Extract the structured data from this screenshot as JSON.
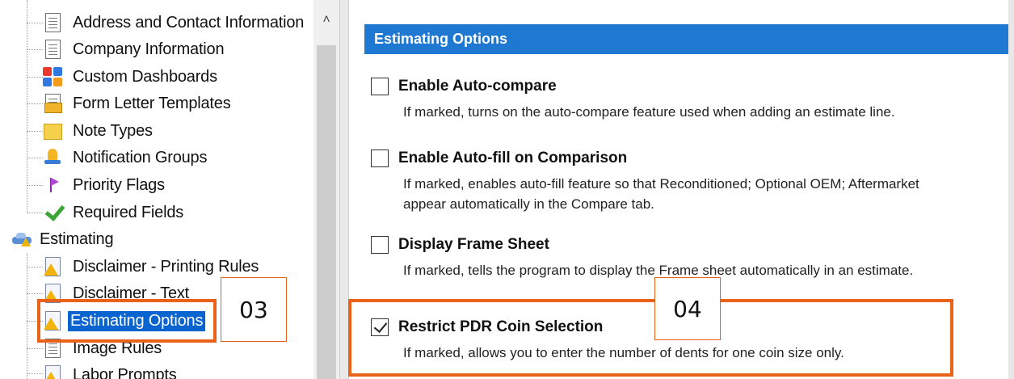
{
  "tree": {
    "items": [
      {
        "label": "Address and Contact Information",
        "icon": "document-list-icon"
      },
      {
        "label": "Company Information",
        "icon": "document-list-icon"
      },
      {
        "label": "Custom Dashboards",
        "icon": "dashboard-tiles-icon"
      },
      {
        "label": "Form Letter Templates",
        "icon": "form-letter-icon"
      },
      {
        "label": "Note Types",
        "icon": "sticky-note-icon"
      },
      {
        "label": "Notification Groups",
        "icon": "notification-bell-icon"
      },
      {
        "label": "Priority Flags",
        "icon": "flag-icon"
      },
      {
        "label": "Required Fields",
        "icon": "checkmark-icon"
      }
    ],
    "group": {
      "label": "Estimating",
      "icon": "estimating-car-icon"
    },
    "children": [
      {
        "label": "Disclaimer - Printing Rules",
        "icon": "warning-document-icon"
      },
      {
        "label": "Disclaimer - Text",
        "icon": "warning-document-icon"
      },
      {
        "label": "Estimating Options",
        "icon": "warning-document-icon",
        "selected": true
      },
      {
        "label": "Image Rules",
        "icon": "document-list-icon"
      },
      {
        "label": "Labor Prompts",
        "icon": "warning-document-icon"
      }
    ]
  },
  "options": {
    "header": "Estimating Options",
    "items": [
      {
        "title": "Enable Auto-compare",
        "checked": false,
        "desc": [
          "If marked, turns on the auto-compare feature used when adding an estimate line."
        ]
      },
      {
        "title": "Enable Auto-fill on Comparison",
        "checked": false,
        "desc": [
          "If marked, enables auto-fill feature so that Reconditioned; Optional OEM; Aftermarket",
          "appear automatically in the Compare tab."
        ]
      },
      {
        "title": "Display Frame Sheet",
        "checked": false,
        "desc": [
          "If marked, tells the program to display the Frame sheet automatically in an estimate."
        ]
      },
      {
        "title": "Restrict PDR Coin Selection",
        "checked": true,
        "desc": [
          "If marked, allows you to enter the number of dents for one coin size only."
        ]
      }
    ]
  },
  "callouts": {
    "left": "03",
    "right": "04"
  },
  "colors": {
    "accent": "#e8621a",
    "header": "#1f78d1",
    "selection": "#0a64d0"
  }
}
